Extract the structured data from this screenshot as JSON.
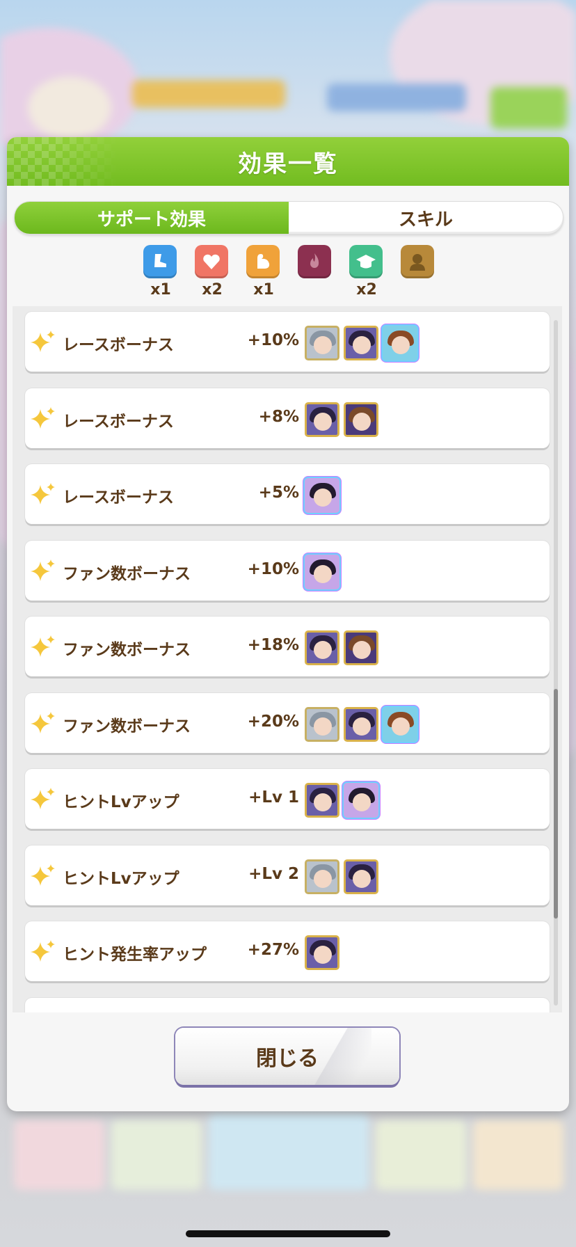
{
  "modal": {
    "title": "効果一覧",
    "close_label": "閉じる"
  },
  "tabs": [
    {
      "label": "サポート効果",
      "active": true
    },
    {
      "label": "スキル",
      "active": false
    }
  ],
  "type_filters": [
    {
      "icon": "speed-icon",
      "color": "#3e9be8",
      "count": "x1"
    },
    {
      "icon": "stamina-heart-icon",
      "color": "#f07565",
      "count": "x2"
    },
    {
      "icon": "power-arm-icon",
      "color": "#f0a23a",
      "count": "x1"
    },
    {
      "icon": "guts-flame-icon",
      "color": "#8c3050",
      "count": ""
    },
    {
      "icon": "wisdom-cap-icon",
      "color": "#43bf8c",
      "count": "x2"
    },
    {
      "icon": "friend-silhouette-icon",
      "color": "#b8893a",
      "count": ""
    }
  ],
  "effects": [
    {
      "label": "レースボーナス",
      "value": "+10%",
      "cards": [
        "sr-gray",
        "ssr-dark",
        "rainbow-brown"
      ]
    },
    {
      "label": "レースボーナス",
      "value": "+8%",
      "cards": [
        "ssr-dark",
        "ssr-brown"
      ]
    },
    {
      "label": "レースボーナス",
      "value": "+5%",
      "cards": [
        "rainbow-dark"
      ]
    },
    {
      "label": "ファン数ボーナス",
      "value": "+10%",
      "cards": [
        "rainbow-dark"
      ]
    },
    {
      "label": "ファン数ボーナス",
      "value": "+18%",
      "cards": [
        "ssr-dark",
        "ssr-brown"
      ]
    },
    {
      "label": "ファン数ボーナス",
      "value": "+20%",
      "cards": [
        "sr-gray",
        "ssr-dark",
        "rainbow-brown"
      ]
    },
    {
      "label": "ヒントLvアップ",
      "value": "+Lv 1",
      "cards": [
        "ssr-dark",
        "rainbow-dark"
      ]
    },
    {
      "label": "ヒントLvアップ",
      "value": "+Lv 2",
      "cards": [
        "sr-gray",
        "ssr-dark"
      ]
    },
    {
      "label": "ヒント発生率アップ",
      "value": "+27%",
      "cards": [
        "ssr-dark"
      ]
    }
  ],
  "colors": {
    "accent_green": "#78c226",
    "text_brown": "#5a3a1a",
    "button_border": "#7b72a8"
  }
}
